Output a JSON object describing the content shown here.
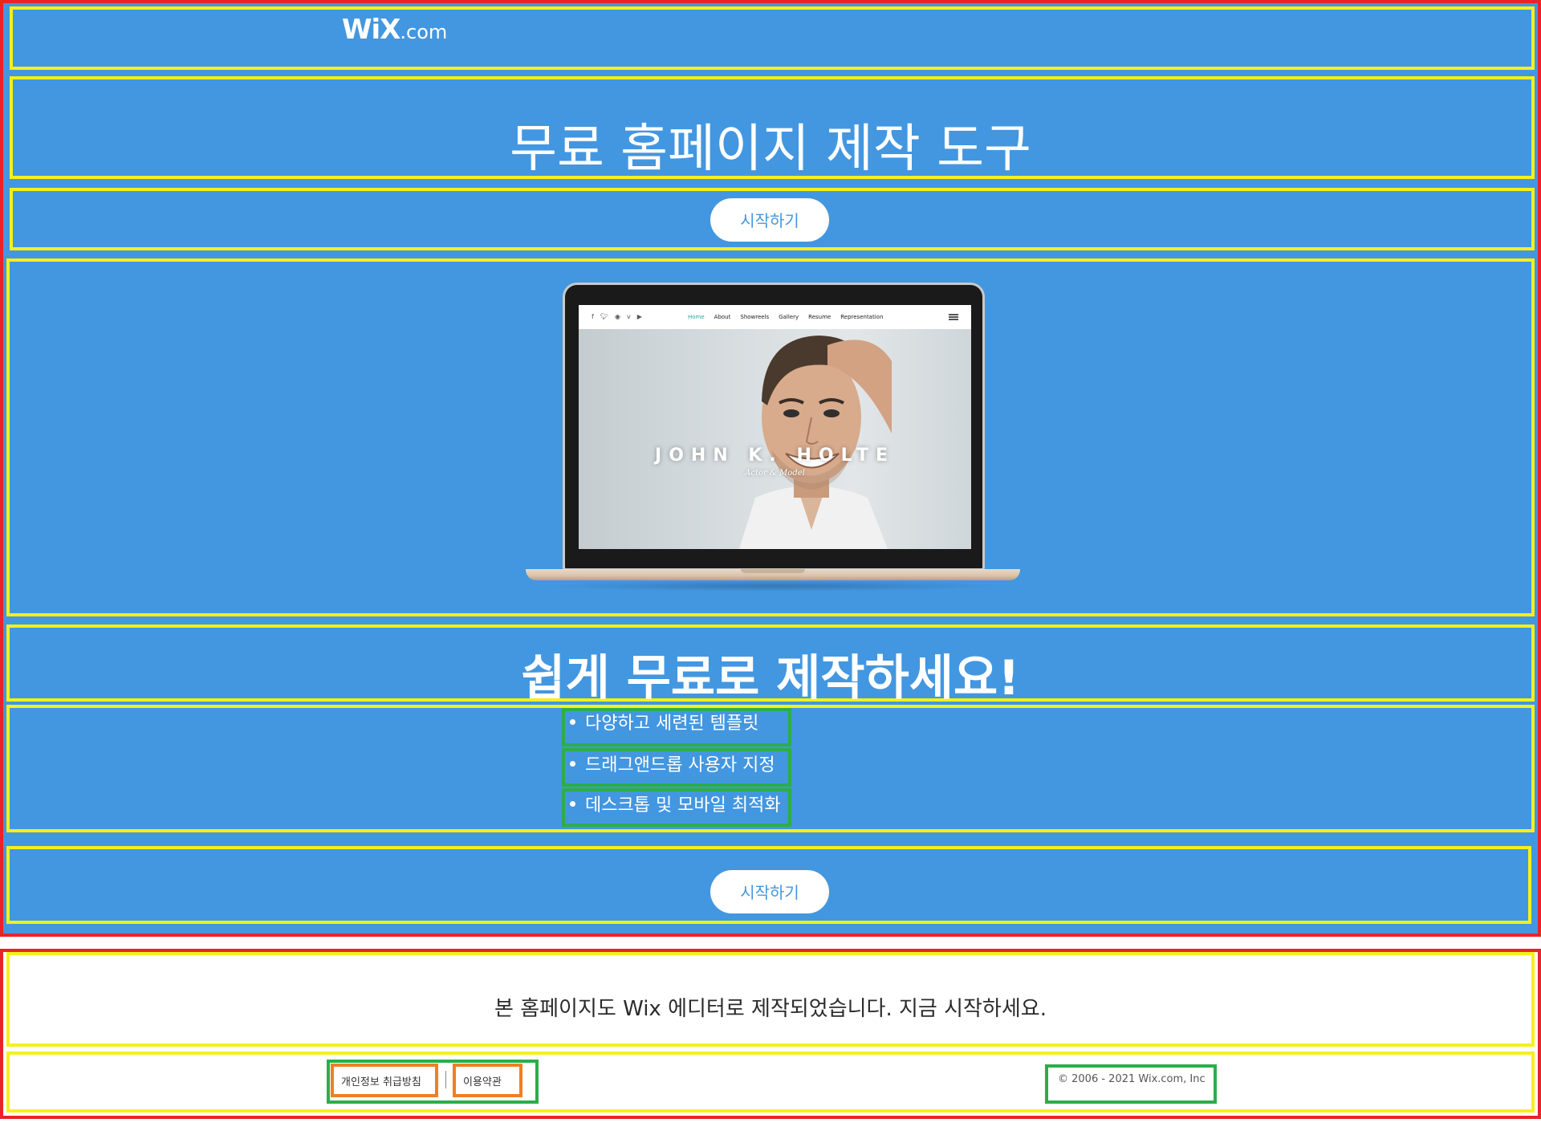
{
  "header": {
    "logo_main": "WiX",
    "logo_suffix": ".com"
  },
  "hero": {
    "title": "무료 홈페이지 제작 도구",
    "cta_label": "시작하기"
  },
  "preview": {
    "social_icons": [
      "facebook-icon",
      "twitter-icon",
      "instagram-icon",
      "vimeo-icon",
      "youtube-icon"
    ],
    "nav_items": [
      "Home",
      "About",
      "Showreels",
      "Gallery",
      "Resume",
      "Representation"
    ],
    "name": "JOHN K. HOLTE",
    "subtitle": "Actor & Model"
  },
  "features": {
    "title": "쉽게 무료로 제작하세요!",
    "items": [
      "다양하고 세련된 템플릿",
      "드래그앤드롭 사용자 지정",
      "데스크톱 및 모바일 최적화"
    ],
    "cta_label": "시작하기"
  },
  "footer": {
    "text": "본 홈페이지도 Wix 에디터로 제작되었습니다. 지금 시작하세요.",
    "links": [
      "개인정보 취급방침",
      "이용약관"
    ],
    "copyright": "© 2006 - 2021 Wix.com, Inc"
  },
  "colors": {
    "primary_blue": "#4397e0",
    "annotation_red": "#e8232a",
    "annotation_yellow": "#f6f01a",
    "annotation_green": "#2bae4a",
    "annotation_orange": "#f07f22"
  }
}
